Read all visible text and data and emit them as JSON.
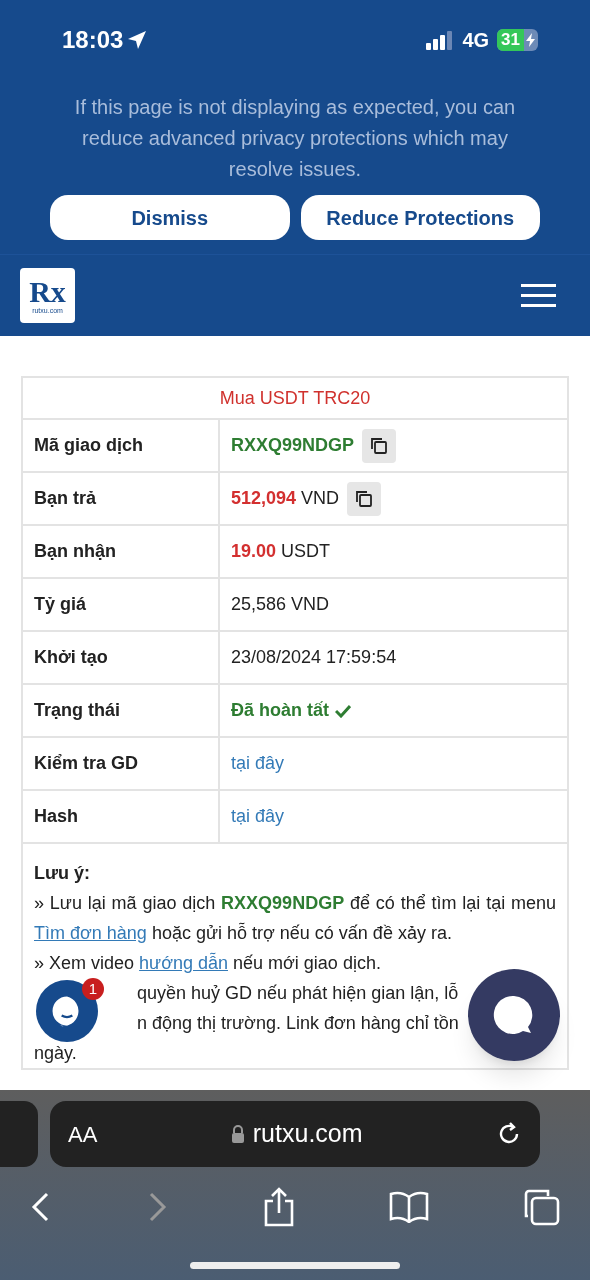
{
  "status_bar": {
    "time": "18:03",
    "network": "4G",
    "battery": "31"
  },
  "privacy_banner": {
    "message": "If this page is not displaying as expected, you can reduce advanced privacy protections which may resolve issues.",
    "buttons": [
      "Dismiss",
      "Reduce Protections"
    ]
  },
  "header": {
    "logo": {
      "letters": "Rx",
      "caption": "rutxu.com"
    }
  },
  "order": {
    "title": "Mua USDT TRC20",
    "rows": [
      {
        "label": "Mã giao dịch",
        "kind": "code",
        "value": "RXXQ99NDGP",
        "copy": true
      },
      {
        "label": "Bạn trả",
        "kind": "amount",
        "value": "512,094",
        "unit": "VND",
        "copy": true
      },
      {
        "label": "Bạn nhận",
        "kind": "amount",
        "value": "19.00",
        "unit": "USDT",
        "copy": false
      },
      {
        "label": "Tỷ giá",
        "kind": "text",
        "value": "25,586 VND",
        "copy": false
      },
      {
        "label": "Khởi tạo",
        "kind": "text",
        "value": "23/08/2024 17:59:54",
        "copy": false
      },
      {
        "label": "Trạng thái",
        "kind": "status",
        "value": "Đã hoàn tất",
        "copy": false
      },
      {
        "label": "Kiểm tra GD",
        "kind": "link",
        "value": "tại đây",
        "copy": false
      },
      {
        "label": "Hash",
        "kind": "link",
        "value": "tại đây",
        "copy": false
      }
    ]
  },
  "notes": {
    "title": "Lưu ý:",
    "paragraphs": [
      {
        "parts": [
          {
            "text": "» Lưu lại mã giao dịch **RXXQ99NDGP** để có thể tìm lại tại menu"
          },
          {
            "text": "Tìm đơn hàng",
            "link": true
          },
          {
            "text": "hoặc gửi hỗ trợ nếu có vấn đề xảy ra."
          }
        ]
      },
      {
        "parts": [
          {
            "text": "» Xem video"
          },
          {
            "text": "hướng dẫn",
            "link": true
          },
          {
            "text": "nếu mới giao dịch."
          }
        ]
      }
    ],
    "partial_lines": [
      "quyền huỷ GD nếu phát hiện gian lận, lỗ",
      "n động thị trường. Link đơn hàng chỉ tồn",
      "ngày."
    ]
  },
  "chat": {
    "badge": "1"
  },
  "browser": {
    "text_size": "AA",
    "url": "rutxu.com"
  }
}
